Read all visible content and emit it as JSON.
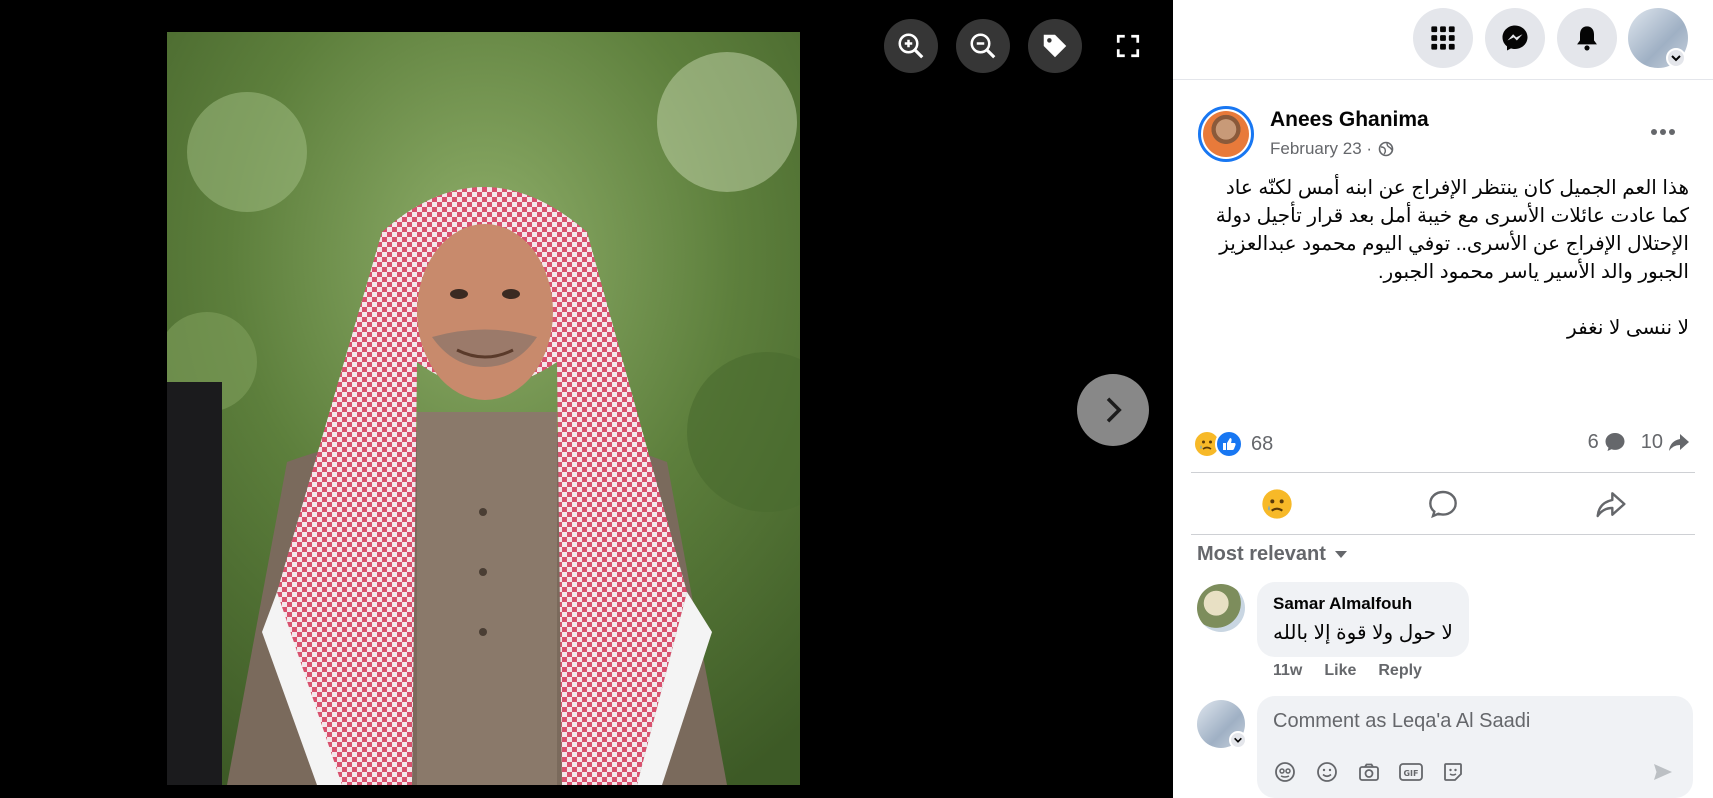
{
  "viewer": {
    "tools": [
      "zoom-in-icon",
      "zoom-out-icon",
      "tag-icon",
      "fullscreen-icon"
    ],
    "next_icon": "chevron-right-icon"
  },
  "topbar": {
    "icons": [
      "menu-grid-icon",
      "messenger-icon",
      "bell-icon"
    ]
  },
  "post": {
    "author": "Anees Ghanima",
    "date": "February 23 ·",
    "text": "هذا العم الجميل كان ينتظر الإفراج عن ابنه أمس لكنّه عاد كما عادت عائلات الأسرى مع خيبة أمل بعد قرار تأجيل دولة الإحتلال الإفراج عن الأسرى.. توفي اليوم محمود عبدالعزيز الجبور والد الأسير ياسر محمود الجبور.\n\nلا ننسى لا نغفر",
    "reaction_count": "68",
    "comment_count": "6",
    "share_count": "10"
  },
  "comments": {
    "sort_label": "Most relevant",
    "items": [
      {
        "author": "Samar Almalfouh",
        "text": "لا حول ولا قوة إلا بالله",
        "time": "11w",
        "like": "Like",
        "reply": "Reply"
      }
    ],
    "input_placeholder": "Comment as Leqa'a Al Saadi"
  },
  "colors": {
    "accent": "#1877f2",
    "secondary_text": "#65676b",
    "bubble_bg": "#f0f2f5"
  }
}
